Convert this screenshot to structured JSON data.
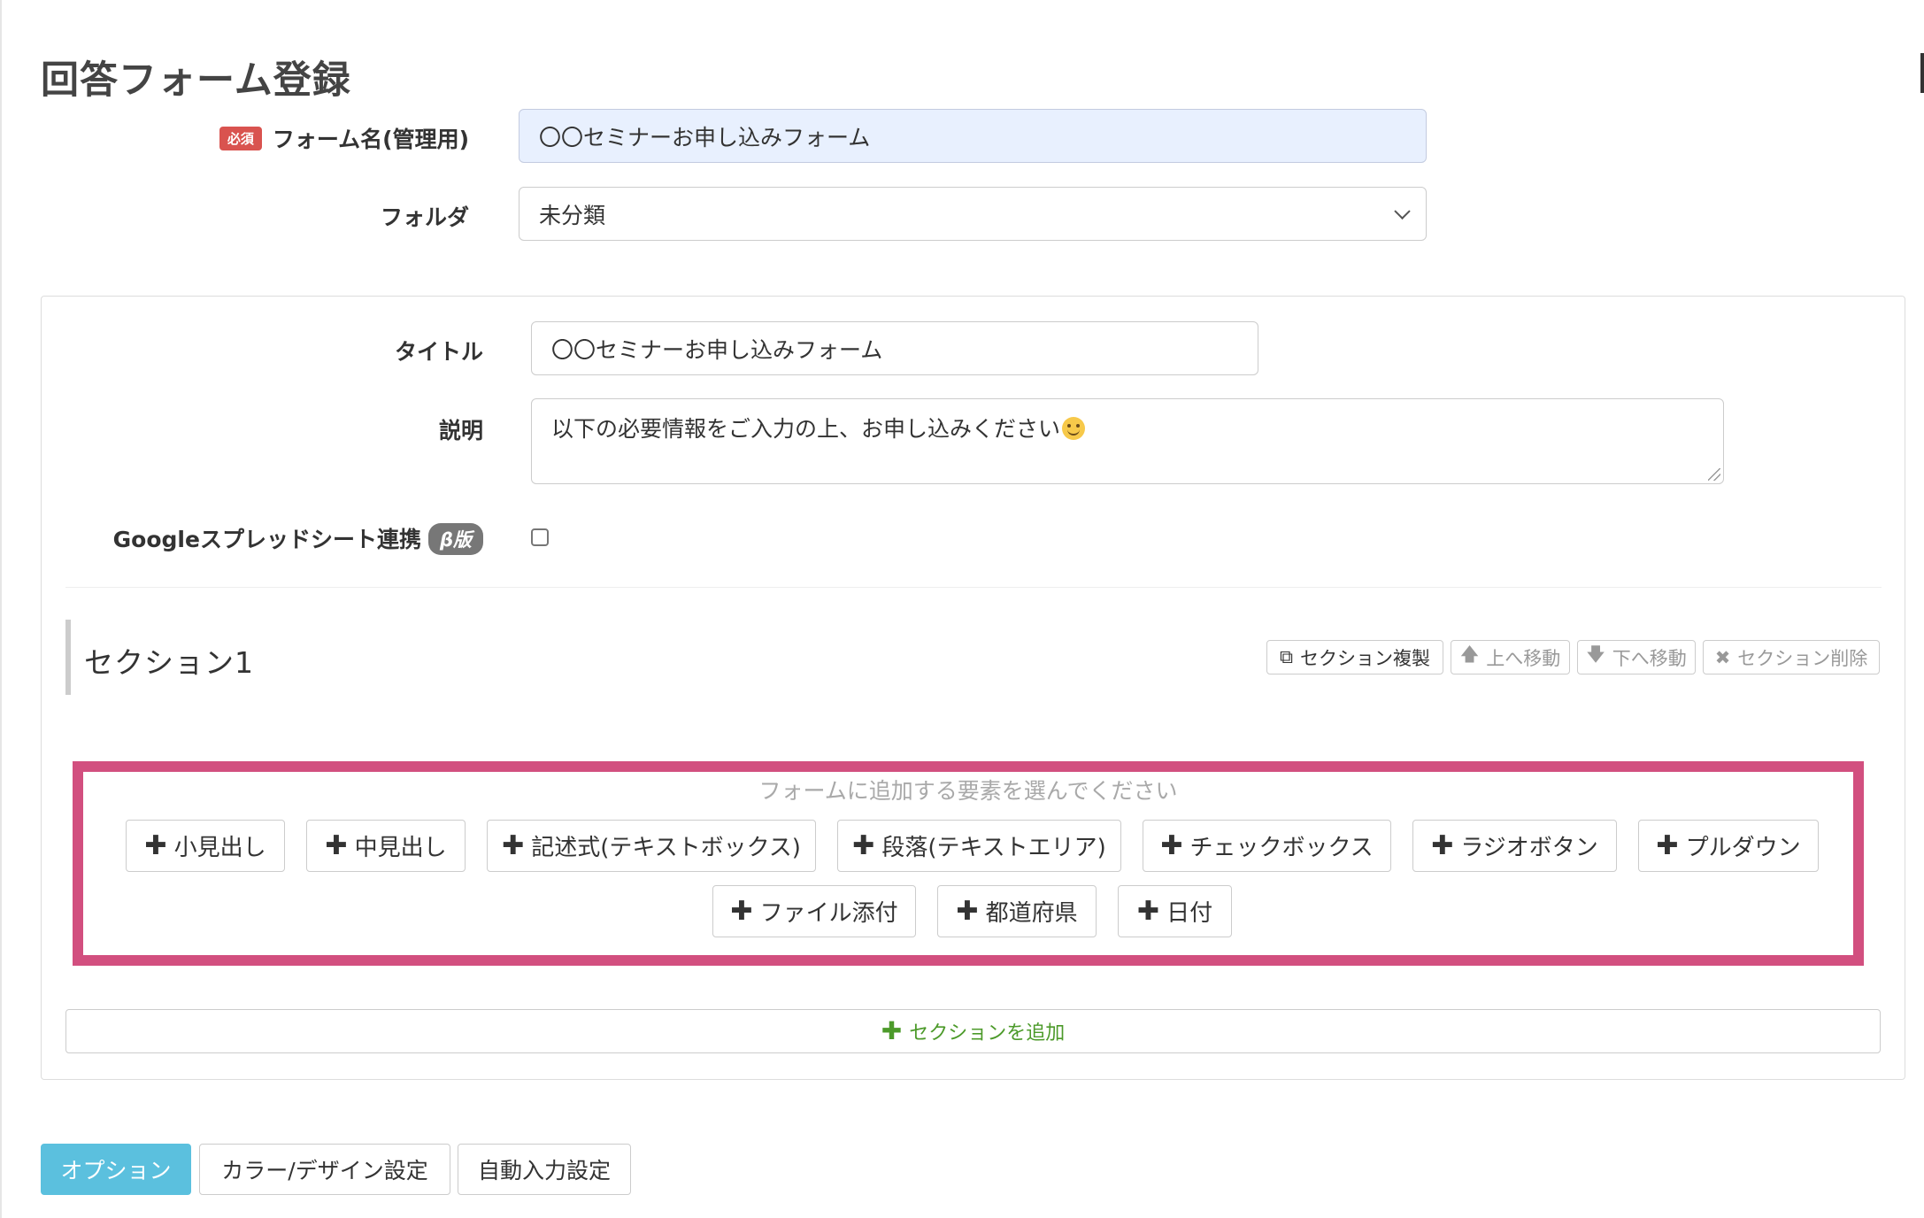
{
  "page": {
    "title": "回答フォーム登録"
  },
  "form": {
    "required_badge": "必須",
    "name_label": "フォーム名(管理用)",
    "name_value": "〇〇セミナーお申し込みフォーム",
    "folder_label": "フォルダ",
    "folder_value": "未分類"
  },
  "panel": {
    "title_label": "タイトル",
    "title_value": "〇〇セミナーお申し込みフォーム",
    "desc_label": "説明",
    "desc_value": "以下の必要情報をご入力の上、お申し込みください",
    "sheet_label": "Googleスプレッドシート連携",
    "beta_badge": "β版",
    "sheet_checked": false
  },
  "section": {
    "title": "セクション1",
    "buttons": {
      "duplicate": "セクション複製",
      "move_up": "上へ移動",
      "move_down": "下へ移動",
      "delete": "セクション削除"
    },
    "hint": "フォームに追加する要素を選んでください",
    "elements": [
      "小見出し",
      "中見出し",
      "記述式(テキストボックス)",
      "段落(テキストエリア)",
      "チェックボックス",
      "ラジオボタン",
      "プルダウン",
      "ファイル添付",
      "都道府県",
      "日付"
    ],
    "add_section": "セクションを追加"
  },
  "tabs": [
    "オプション",
    "カラー/デザイン設定",
    "自動入力設定"
  ],
  "colors": {
    "highlight": "#d24f7f",
    "active_tab": "#5bc0de",
    "required": "#d9534f",
    "add_green": "#4c9a2a"
  }
}
